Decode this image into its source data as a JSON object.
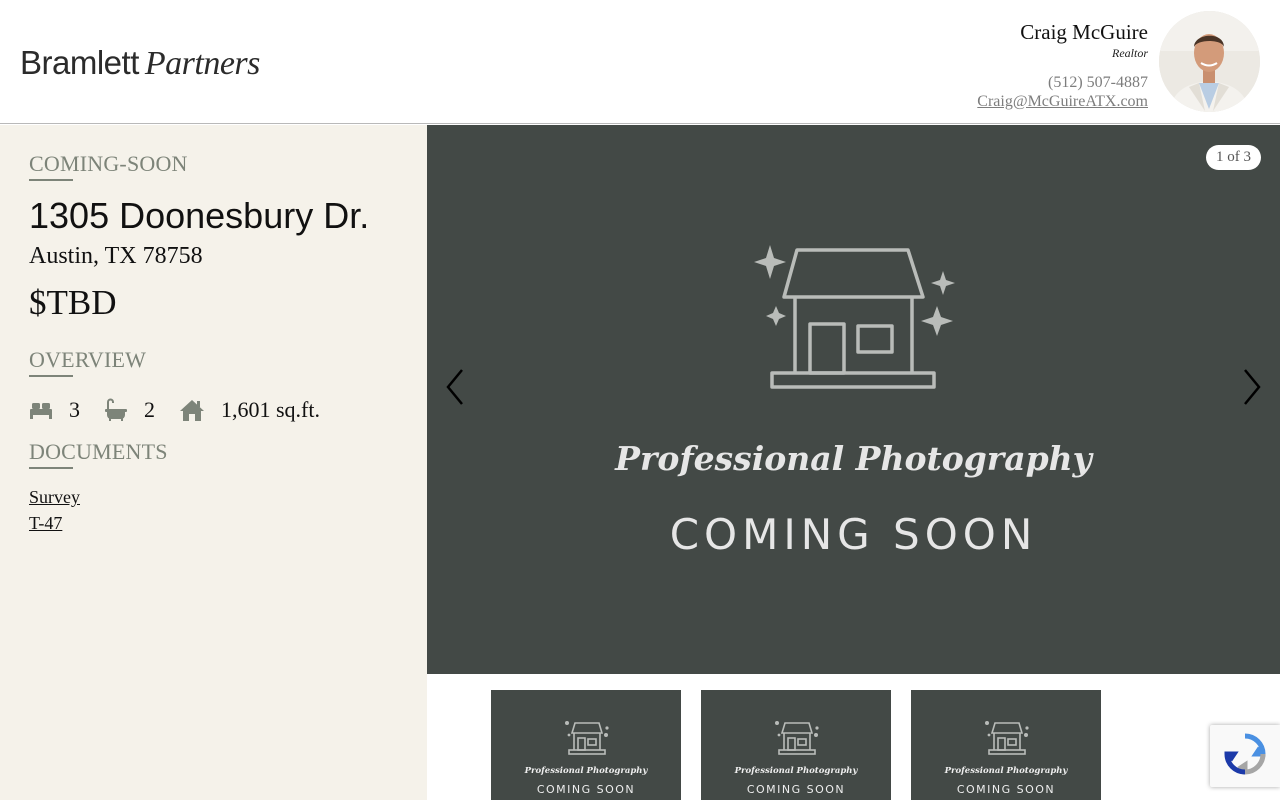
{
  "header": {
    "logo_part1": "Bramlett",
    "logo_part2": "Partners",
    "agent": {
      "name": "Craig McGuire",
      "title": "Realtor",
      "phone": "(512) 507-4887",
      "email": "Craig@McGuireATX.com"
    }
  },
  "listing": {
    "status": "COMING-SOON",
    "address": "1305 Doonesbury Dr.",
    "city": "Austin, TX 78758",
    "price": "$TBD",
    "overview_heading": "OVERVIEW",
    "stats": {
      "beds": "3",
      "baths": "2",
      "sqft": "1,601 sq.ft."
    },
    "documents_heading": "DOCUMENTS",
    "documents": [
      "Survey",
      "T-47"
    ]
  },
  "gallery": {
    "counter": "1 of 3",
    "slide_title": "Professional Photography",
    "slide_subtitle": "COMING SOON",
    "thumbnails": [
      {
        "title": "Professional Photography",
        "subtitle": "COMING SOON"
      },
      {
        "title": "Professional Photography",
        "subtitle": "COMING SOON"
      },
      {
        "title": "Professional Photography",
        "subtitle": "COMING SOON"
      }
    ]
  },
  "icons": {
    "bed": "bed-icon",
    "bath": "bathtub-icon",
    "home": "house-icon",
    "prev": "chevron-left-icon",
    "next": "chevron-right-icon",
    "recaptcha": "recaptcha-icon"
  },
  "colors": {
    "sidebar_bg": "#f5f2ea",
    "accent": "#7d8479",
    "gallery_bg": "#434946"
  }
}
